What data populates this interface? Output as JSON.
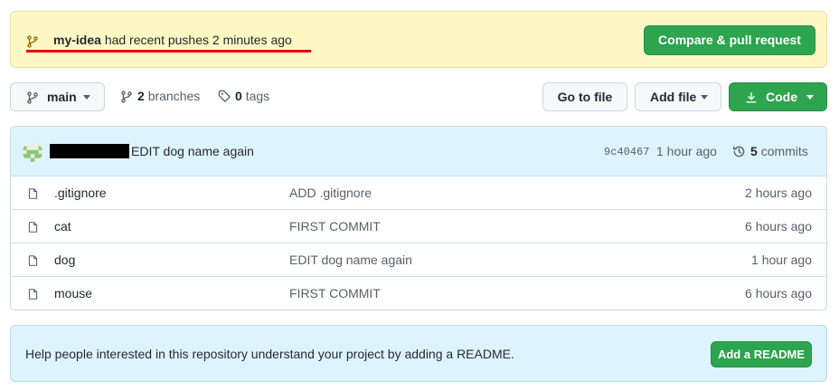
{
  "banner": {
    "branch_name": "my-idea",
    "message": "had recent pushes 2 minutes ago",
    "compare_button": "Compare & pull request",
    "icon": "git-branch-icon"
  },
  "toolbar": {
    "branch_selector": "main",
    "branches_count": "2",
    "branches_label": "branches",
    "tags_count": "0",
    "tags_label": "tags",
    "go_to_file": "Go to file",
    "add_file": "Add file",
    "code": "Code"
  },
  "commit": {
    "author": "",
    "message": "EDIT dog name again",
    "sha": "9c40467",
    "time": "1 hour ago",
    "commits_count": "5",
    "commits_label": "commits"
  },
  "files": [
    {
      "name": ".gitignore",
      "message": "ADD .gitignore",
      "age": "2 hours ago"
    },
    {
      "name": "cat",
      "message": "FIRST COMMIT",
      "age": "6 hours ago"
    },
    {
      "name": "dog",
      "message": "EDIT dog name again",
      "age": "1 hour ago"
    },
    {
      "name": "mouse",
      "message": "FIRST COMMIT",
      "age": "6 hours ago"
    }
  ],
  "readme": {
    "text": "Help people interested in this repository understand your project by adding a README.",
    "button": "Add a README"
  },
  "colors": {
    "accent_green": "#2da44e",
    "banner_bg": "#fff8c5",
    "commit_bg": "#ddf4ff",
    "annotation_red": "#e3000b"
  }
}
